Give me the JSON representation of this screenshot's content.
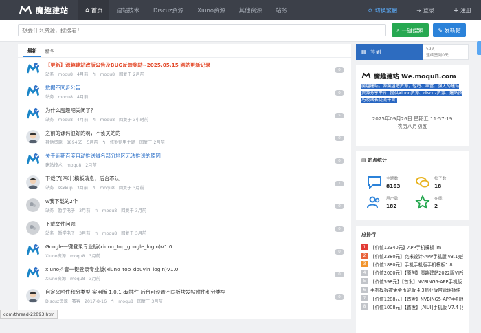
{
  "topbar": {
    "logo_text": "魔趣建站",
    "nav": [
      {
        "label": "首页",
        "active": true
      },
      {
        "label": "建站技术",
        "active": false
      },
      {
        "label": "Discuz资源",
        "active": false
      },
      {
        "label": "Xiuno资源",
        "active": false
      },
      {
        "label": "其他资源",
        "active": false
      },
      {
        "label": "站务",
        "active": false
      }
    ],
    "switch_label": "切换繁體",
    "login_label": "登录",
    "register_label": "注册"
  },
  "search": {
    "placeholder": "想要什么资源，搜搜看！",
    "search_button": "一键搜索",
    "post_button": "发新帖"
  },
  "tabs": {
    "latest": "最新",
    "featured": "精华"
  },
  "threads": [
    {
      "title": "【更新】源趣建站改版公告及BUG反馈奖励~2025.05.15 网站更新记录",
      "forum": "站务",
      "author": "moqu8",
      "time": "4月前",
      "reply_user": "moqu8",
      "reply_time": "回复于 2月前",
      "count": "0",
      "style": "hot",
      "avatar": "logo"
    },
    {
      "title": "数据不同步公告",
      "forum": "站务",
      "author": "moqu8",
      "time": "4月前",
      "reply_user": "",
      "reply_time": "",
      "count": "0",
      "style": "blue",
      "avatar": "logo"
    },
    {
      "title": "为什么魔趣吧关闭了？",
      "forum": "站务",
      "author": "moqu8",
      "time": "4月前",
      "reply_user": "moqu8",
      "reply_time": "回复于 3小时前",
      "count": "5",
      "style": "",
      "avatar": "logo"
    },
    {
      "title": "之前的课码很好的啊，不该关站的",
      "forum": "其他资源",
      "author": "889465",
      "time": "5月前",
      "reply_user": "修罗铠甲主题",
      "reply_time": "回复于 2月前",
      "count": "0",
      "style": "",
      "avatar": "person"
    },
    {
      "title": "关于近期百度自动推送域名部分地区无法推送的原因",
      "forum": "建站技术",
      "author": "moqu8",
      "time": "2月前",
      "reply_user": "",
      "reply_time": "",
      "count": "0",
      "style": "blue",
      "avatar": "logo"
    },
    {
      "title": "下载了[四叶]模板消息，后台不认",
      "forum": "站务",
      "author": "ssxkup",
      "time": "3月前",
      "reply_user": "moqu8",
      "reply_time": "回复于 3月前",
      "count": "1",
      "style": "",
      "avatar": "person"
    },
    {
      "title": "w我下载的2个",
      "forum": "站务",
      "author": "暂学电子",
      "time": "3月前",
      "reply_user": "moqu8",
      "reply_time": "回复于 3月前",
      "count": "0",
      "style": "",
      "avatar": "gray"
    },
    {
      "title": "下载文件问题",
      "forum": "站务",
      "author": "暂学电子",
      "time": "3月前",
      "reply_user": "moqu8",
      "reply_time": "回复于 3月前",
      "count": "0",
      "style": "",
      "avatar": "gray"
    },
    {
      "title": "Google一键登录专业版(xiuno_top_google_login)V1.0",
      "forum": "Xiuno资源",
      "author": "moqu8",
      "time": "3月前",
      "reply_user": "",
      "reply_time": "",
      "count": "0",
      "style": "",
      "avatar": "logo"
    },
    {
      "title": "xiuno抖音一键登录专业版(xiuno_top_douyin_login)V1.0",
      "forum": "Xiuno资源",
      "author": "moqu8",
      "time": "3月前",
      "reply_user": "",
      "reply_time": "",
      "count": "0",
      "style": "",
      "avatar": "logo"
    },
    {
      "title": "自定义附件积分类型 实用版 1.0.1 dz插件 后台可设置不同板块发帖附件积分类型",
      "forum": "Discuz资源",
      "author": "赛客",
      "time": "2017-8-16",
      "reply_user": "moqu8",
      "reply_time": "回复于 3月前",
      "count": "0",
      "style": "",
      "avatar": "person"
    }
  ],
  "status_url": "com/thread-22893.htm",
  "sidebar": {
    "signin_label": "签到",
    "signin_count": "59人",
    "signin_streak": "连续签到0天",
    "brand_name": "魔趣建站 We.moqu8.com",
    "brand_desc": "魔趣建站，源魔趣吧资源，轻巧、丰富、强大的建站资源分享平台! 提供Xiuno资源、discuz资源、建站技巧及站长交流平台!",
    "date": "2025年09月26日 星期五 11:57:19",
    "lunar": "农历八月初五",
    "stats_title": "站点统计",
    "stats": [
      {
        "label": "主题数",
        "value": "8163",
        "icon": "chat-icon"
      },
      {
        "label": "帖子数",
        "value": "18",
        "icon": "comments-icon"
      },
      {
        "label": "用户数",
        "value": "182",
        "icon": "users-icon"
      },
      {
        "label": "在线",
        "value": "2",
        "icon": "star-icon"
      }
    ],
    "rank_title": "总排行",
    "rank": [
      {
        "no": "1",
        "text": "【价值12340元】APP手机模板 lm"
      },
      {
        "no": "2",
        "text": "【价值2380元】克米设计-APP手机版 v3.1完整破"
      },
      {
        "no": "3",
        "text": "【价值1880元】手机手机版手机模板1.8"
      },
      {
        "no": "4",
        "text": "【价值2000元】【原创】魔趣建站2022版VIP开通"
      },
      {
        "no": "5",
        "text": "【价值598元】【首发】NVBING5-APP手机版 真"
      },
      {
        "no": "6",
        "text": "手机模板被免金币破版 4.3商业版带管理插件"
      },
      {
        "no": "7",
        "text": "【价值1288元】【首发】NVBING5-APP手机版"
      },
      {
        "no": "8",
        "text": "【价值1008元】【首发】[AIUI]手机版 V7.4 (全网"
      }
    ]
  }
}
